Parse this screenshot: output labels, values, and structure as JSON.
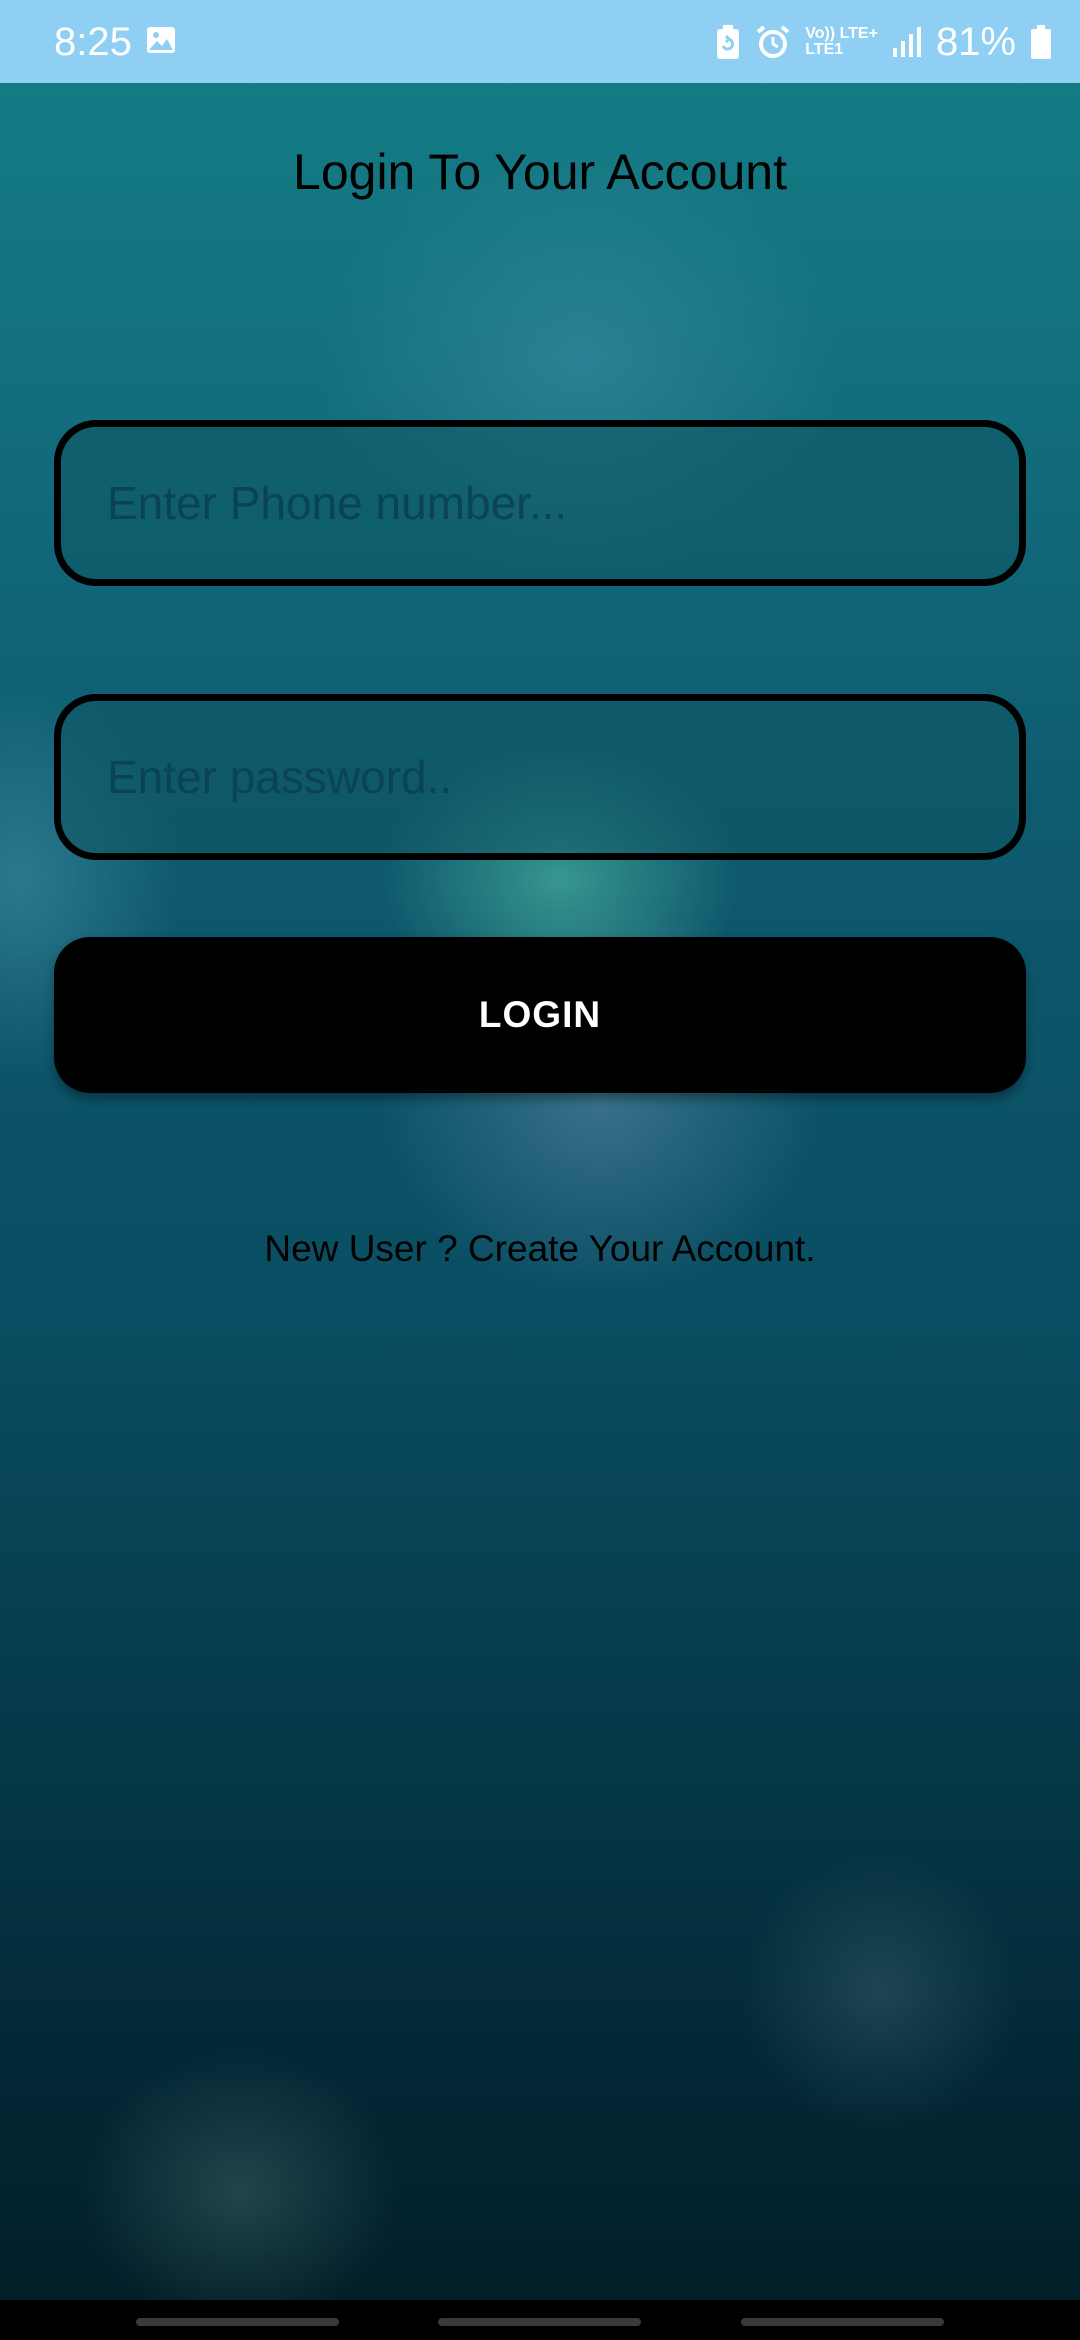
{
  "status_bar": {
    "time": "8:25",
    "network_top": "Vo)) LTE+",
    "network_bottom": "LTE1",
    "battery_percent": "81%",
    "icons": [
      "gallery-icon",
      "battery-saver-icon",
      "alarm-icon",
      "signal-icon",
      "battery-icon"
    ]
  },
  "page": {
    "title": "Login To Your Account"
  },
  "form": {
    "phone_placeholder": "Enter Phone number...",
    "phone_value": "",
    "password_placeholder": "Enter password..",
    "password_value": "",
    "login_label": "LOGIN"
  },
  "footer": {
    "signup_text": "New User ? Create Your Account."
  },
  "colors": {
    "status_bar": "#8ecff3",
    "background_top": "#137f86",
    "background_bottom": "#021d27",
    "button": "#000000"
  }
}
